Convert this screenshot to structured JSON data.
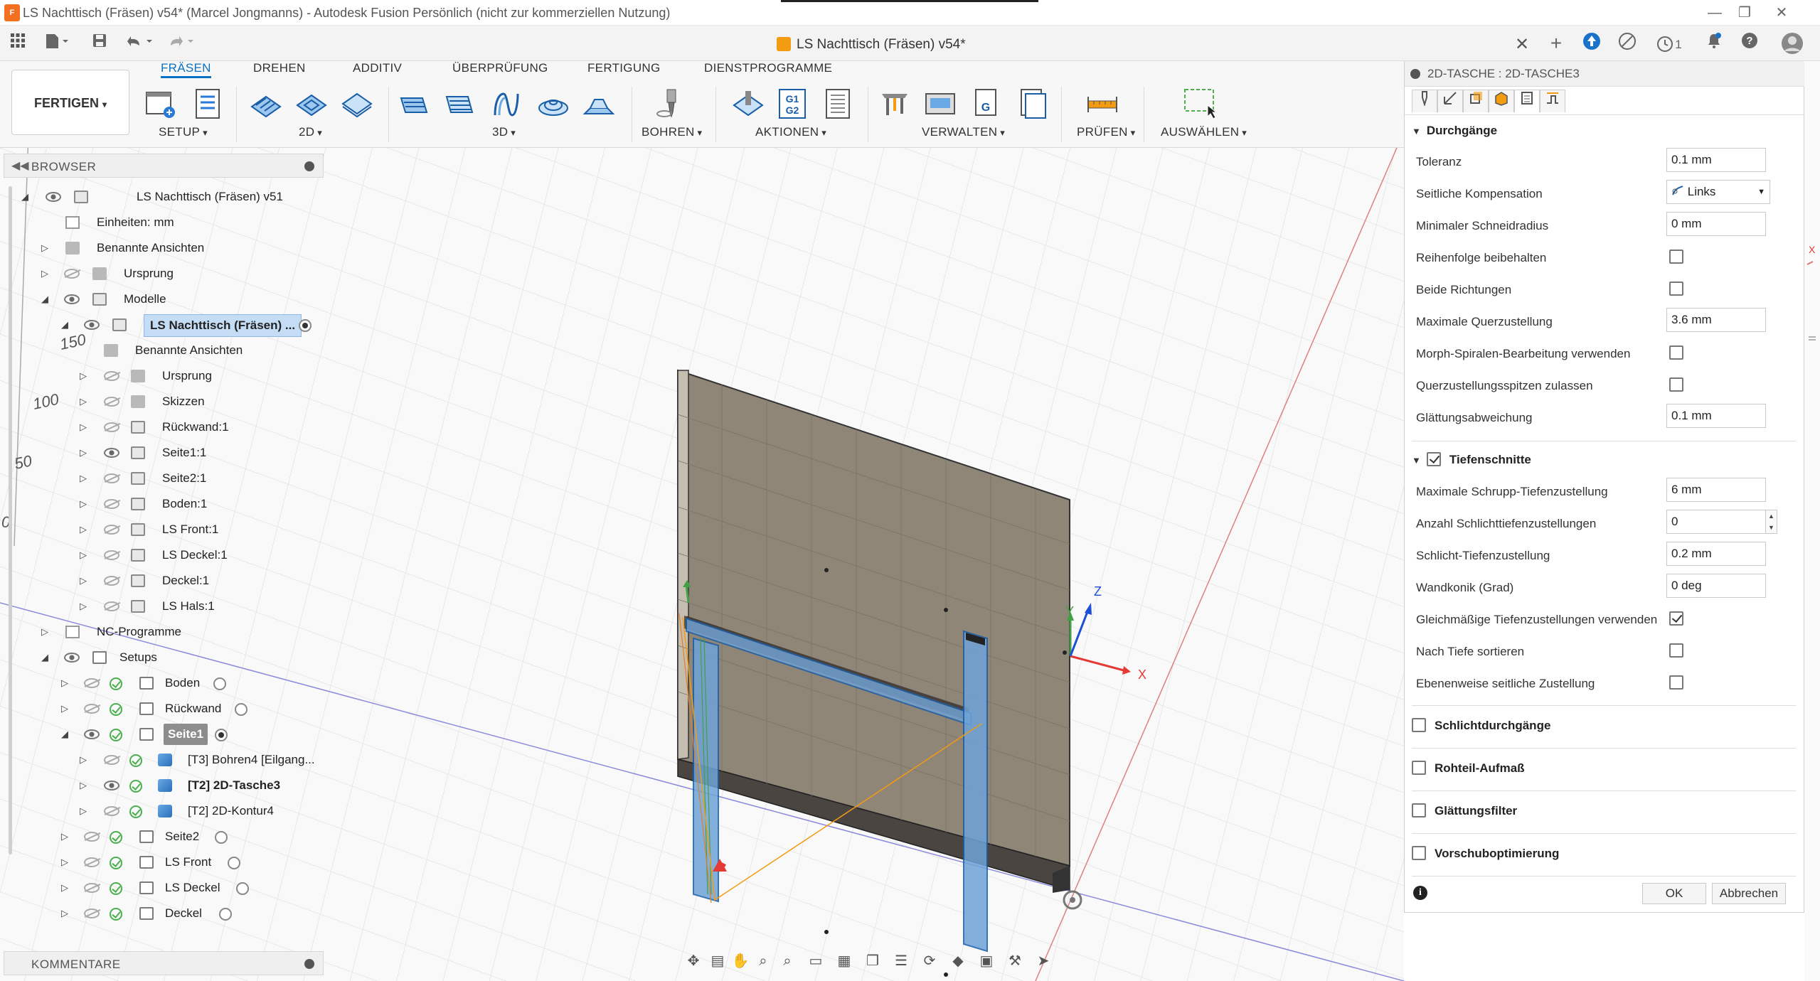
{
  "window": {
    "title": "LS Nachttisch (Fräsen) v54* (Marcel Jongmanns) - Autodesk Fusion Persönlich (nicht zur kommerziellen Nutzung)",
    "app_icon": "F",
    "controls": [
      "—",
      "❐",
      "✕"
    ]
  },
  "doc_tab": {
    "title": "LS Nachttisch (Fräsen) v54*",
    "close": "✕"
  },
  "quick_access": {
    "icons": [
      "grid-menu-icon",
      "file-icon",
      "save-icon",
      "undo-icon",
      "redo-icon"
    ],
    "right_icons": [
      "add-tab-icon",
      "extensions-icon",
      "offline-icon",
      "jobs-icon",
      "notifications-icon",
      "help-icon",
      "profile-icon"
    ],
    "jobs_count": "1"
  },
  "ribbon": {
    "workspace": "FERTIGEN",
    "tabs": [
      "FRÄSEN",
      "DREHEN",
      "ADDITIV",
      "ÜBERPRÜFUNG",
      "FERTIGUNG",
      "DIENSTPROGRAMME"
    ],
    "active_tab": "FRÄSEN",
    "groups": [
      "SETUP",
      "2D",
      "3D",
      "BOHREN",
      "AKTIONEN",
      "VERWALTEN",
      "PRÜFEN",
      "AUSWÄHLEN"
    ]
  },
  "browser": {
    "title": "BROWSER",
    "items": [
      {
        "label": "LS Nachttisch (Fräsen) v51"
      },
      {
        "label": "Einheiten: mm"
      },
      {
        "label": "Benannte Ansichten"
      },
      {
        "label": "Ursprung"
      },
      {
        "label": "Modelle"
      },
      {
        "label": "LS Nachttisch (Fräsen) ..."
      },
      {
        "label": "Benannte Ansichten"
      },
      {
        "label": "Ursprung"
      },
      {
        "label": "Skizzen"
      },
      {
        "label": "Rückwand:1"
      },
      {
        "label": "Seite1:1"
      },
      {
        "label": "Seite2:1"
      },
      {
        "label": "Boden:1"
      },
      {
        "label": "LS Front:1"
      },
      {
        "label": "LS Deckel:1"
      },
      {
        "label": "Deckel:1"
      },
      {
        "label": "LS Hals:1"
      },
      {
        "label": "NC-Programme"
      },
      {
        "label": "Setups"
      },
      {
        "label": "Boden"
      },
      {
        "label": "Rückwand"
      },
      {
        "label": "Seite1"
      },
      {
        "label": "[T3] Bohren4 [Eilgang..."
      },
      {
        "label": "[T2] 2D-Tasche3"
      },
      {
        "label": "[T2] 2D-Kontur4"
      },
      {
        "label": "Seite2"
      },
      {
        "label": "LS Front"
      },
      {
        "label": "LS Deckel"
      },
      {
        "label": "Deckel"
      }
    ],
    "comments": "KOMMENTARE"
  },
  "viewport": {
    "ruler_labels": [
      "150",
      "100",
      "50",
      "0"
    ],
    "axes": {
      "x": "X",
      "y": "Y",
      "z": "Z"
    },
    "right_axis_label": "X"
  },
  "properties": {
    "title": "2D-TASCHE : 2D-TASCHE3",
    "sections": {
      "durchgaenge": "Durchgänge",
      "tiefenschnitte": "Tiefenschnitte",
      "schlicht": "Schlichtdurchgänge",
      "rohteil": "Rohteil-Aufmaß",
      "glaettung": "Glättungsfilter",
      "vorschub": "Vorschuboptimierung"
    },
    "fields": {
      "toleranz": {
        "label": "Toleranz",
        "value": "0.1 mm"
      },
      "seitliche_kompensation": {
        "label": "Seitliche Kompensation",
        "value": "Links"
      },
      "min_schneidradius": {
        "label": "Minimaler Schneidradius",
        "value": "0 mm"
      },
      "reihenfolge": {
        "label": "Reihenfolge beibehalten",
        "checked": false
      },
      "beide_richtungen": {
        "label": "Beide Richtungen",
        "checked": false
      },
      "max_querzustellung": {
        "label": "Maximale Querzustellung",
        "value": "3.6 mm"
      },
      "morph": {
        "label": "Morph-Spiralen-Bearbeitung verwenden",
        "checked": false
      },
      "querzustellungsspitzen": {
        "label": "Querzustellungsspitzen zulassen",
        "checked": false
      },
      "glaettungsabweichung": {
        "label": "Glättungsabweichung",
        "value": "0.1 mm"
      },
      "max_schrupp": {
        "label": "Maximale Schrupp-Tiefenzustellung",
        "value": "6 mm"
      },
      "anzahl_schlicht": {
        "label": "Anzahl Schlichttiefenzustellungen",
        "value": "0"
      },
      "schlicht_tiefe": {
        "label": "Schlicht-Tiefenzustellung",
        "value": "0.2 mm"
      },
      "wandkonik": {
        "label": "Wandkonik (Grad)",
        "value": "0 deg"
      },
      "gleichmaessig": {
        "label": "Gleichmäßige Tiefenzustellungen verwenden",
        "checked": true
      },
      "nach_tiefe": {
        "label": "Nach Tiefe sortieren",
        "checked": false
      },
      "ebenenweise": {
        "label": "Ebenenweise seitliche Zustellung",
        "checked": false
      }
    },
    "ok": "OK",
    "cancel": "Abbrechen"
  }
}
